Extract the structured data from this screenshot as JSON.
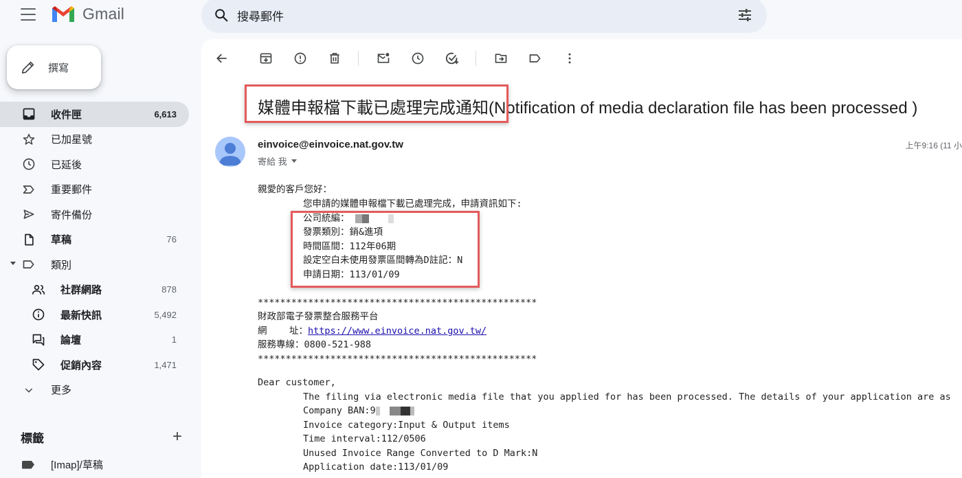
{
  "app": {
    "name": "Gmail"
  },
  "search": {
    "placeholder": "搜尋郵件"
  },
  "compose": {
    "label": "撰寫"
  },
  "sidebar": {
    "items": [
      {
        "label": "收件匣",
        "count": "6,613"
      },
      {
        "label": "已加星號",
        "count": ""
      },
      {
        "label": "已延後",
        "count": ""
      },
      {
        "label": "重要郵件",
        "count": ""
      },
      {
        "label": "寄件備份",
        "count": ""
      },
      {
        "label": "草稿",
        "count": "76"
      },
      {
        "label": "類別",
        "count": ""
      },
      {
        "label": "社群網路",
        "count": "878"
      },
      {
        "label": "最新快訊",
        "count": "5,492"
      },
      {
        "label": "論壇",
        "count": "1"
      },
      {
        "label": "促銷內容",
        "count": "1,471"
      },
      {
        "label": "更多",
        "count": ""
      }
    ],
    "labels_header": "標籤",
    "labels_add": "+",
    "label_items": [
      {
        "label": "[Imap]/草稿"
      }
    ]
  },
  "email": {
    "subject": "媒體申報檔下載已處理完成通知(Notification of media declaration file has been processed )",
    "sender": "einvoice@einvoice.nat.gov.tw",
    "to": "寄給 我",
    "time": "上午9:16 (11 小",
    "body": {
      "greeting": "親愛的客戶您好：",
      "intro": "您申請的媒體申報檔下載已處理完成，申請資訊如下:",
      "company_label": "公司統編：",
      "category": "發票類別：銷&進項",
      "period": "時間區間：112年06期",
      "blank_setting": "設定空白未使用發票區間轉為D註記：N",
      "apply_date": "申請日期：113/01/09",
      "stars1": "**************************************************",
      "org": "財政部電子發票整合服務平台",
      "url_label": "網    址：",
      "url": "https://www.einvoice.nat.gov.tw/",
      "hotline": "服務專線：0800-521-988",
      "stars2": "**************************************************",
      "en_greeting": "Dear customer,",
      "en_intro": "The filing via electronic media file that you applied for has been processed. The details of your application are as",
      "en_company": "Company BAN:9",
      "en_category": "Invoice category:Input & Output items",
      "en_interval": "Time interval:112/0506",
      "en_unused": "Unused Invoice Range Converted to D Mark:N",
      "en_apply": "Application date:113/01/09"
    }
  },
  "colors": {
    "highlight": "#e45a5a",
    "active_bg": "#dde1e6",
    "link": "#1a0dab"
  }
}
